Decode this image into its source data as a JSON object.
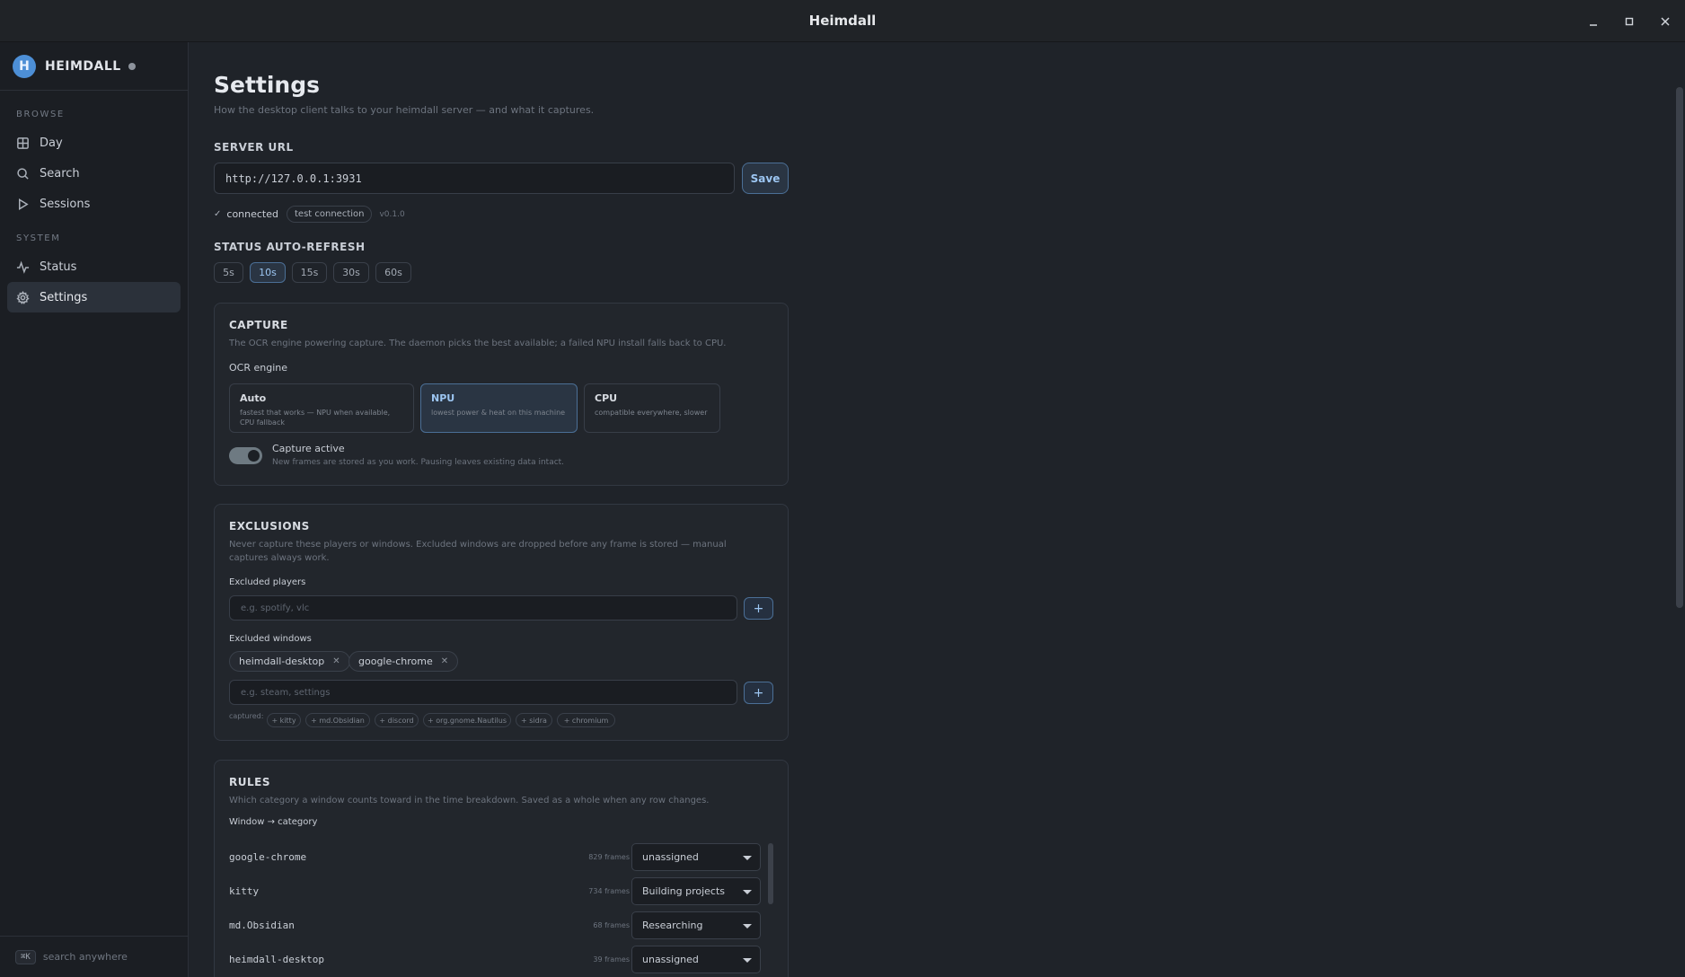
{
  "window": {
    "title": "Heimdall"
  },
  "sidebar": {
    "brand": {
      "logo_letter": "H",
      "name": "HEIMDALL"
    },
    "sections": [
      {
        "label": "BROWSE",
        "items": [
          {
            "label": "Day",
            "icon": "grid-icon"
          },
          {
            "label": "Search",
            "icon": "search-icon"
          },
          {
            "label": "Sessions",
            "icon": "play-icon"
          }
        ]
      },
      {
        "label": "SYSTEM",
        "items": [
          {
            "label": "Status",
            "icon": "activity-icon"
          },
          {
            "label": "Settings",
            "icon": "gear-icon",
            "active": true
          }
        ]
      }
    ],
    "footer": {
      "shortcut": "⌘K",
      "hint": "search anywhere"
    }
  },
  "page": {
    "title": "Settings",
    "subtitle": "How the desktop client talks to your heimdall server — and what it captures."
  },
  "server": {
    "label": "SERVER URL",
    "url": "http://127.0.0.1:3931",
    "save_label": "Save",
    "status_check": "✓",
    "status_text": "connected",
    "test_label": "test connection",
    "version": "v0.1.0"
  },
  "auto_refresh": {
    "label": "STATUS AUTO-REFRESH",
    "options": [
      "5s",
      "10s",
      "15s",
      "30s",
      "60s"
    ],
    "selected": "10s"
  },
  "capture": {
    "title": "CAPTURE",
    "description": "The OCR engine powering capture. The daemon picks the best available; a failed NPU install falls back to CPU.",
    "engine_label": "OCR engine",
    "engines": [
      {
        "title": "Auto",
        "desc": "fastest that works — NPU when available, CPU fallback"
      },
      {
        "title": "NPU",
        "desc": "lowest power & heat on this machine"
      },
      {
        "title": "CPU",
        "desc": "compatible everywhere, slower"
      }
    ],
    "selected_engine": "NPU",
    "toggle_label": "Capture active",
    "toggle_desc": "New frames are stored as you work. Pausing leaves existing data intact.",
    "toggle_on": true
  },
  "exclusions": {
    "title": "EXCLUSIONS",
    "description": "Never capture these players or windows. Excluded windows are dropped before any frame is stored — manual captures always work.",
    "players_label": "Excluded players",
    "players_placeholder": "e.g. spotify, vlc",
    "windows_label": "Excluded windows",
    "windows": [
      "heimdall-desktop",
      "google-chrome"
    ],
    "windows_placeholder": "e.g. steam, settings",
    "captured_label": "captured:",
    "captured": [
      "+ kitty",
      "+ md.Obsidian",
      "+ discord",
      "+ org.gnome.Nautilus",
      "+ sidra",
      "+ chromium"
    ]
  },
  "rules": {
    "title": "RULES",
    "description": "Which category a window counts toward in the time breakdown. Saved as a whole when any row changes.",
    "mapping_label": "Window → category",
    "rows": [
      {
        "window": "google-chrome",
        "frames": "829 frames",
        "category": "unassigned"
      },
      {
        "window": "kitty",
        "frames": "734 frames",
        "category": "Building projects"
      },
      {
        "window": "md.Obsidian",
        "frames": "68 frames",
        "category": "Researching"
      },
      {
        "window": "heimdall-desktop",
        "frames": "39 frames",
        "category": "unassigned"
      }
    ]
  }
}
